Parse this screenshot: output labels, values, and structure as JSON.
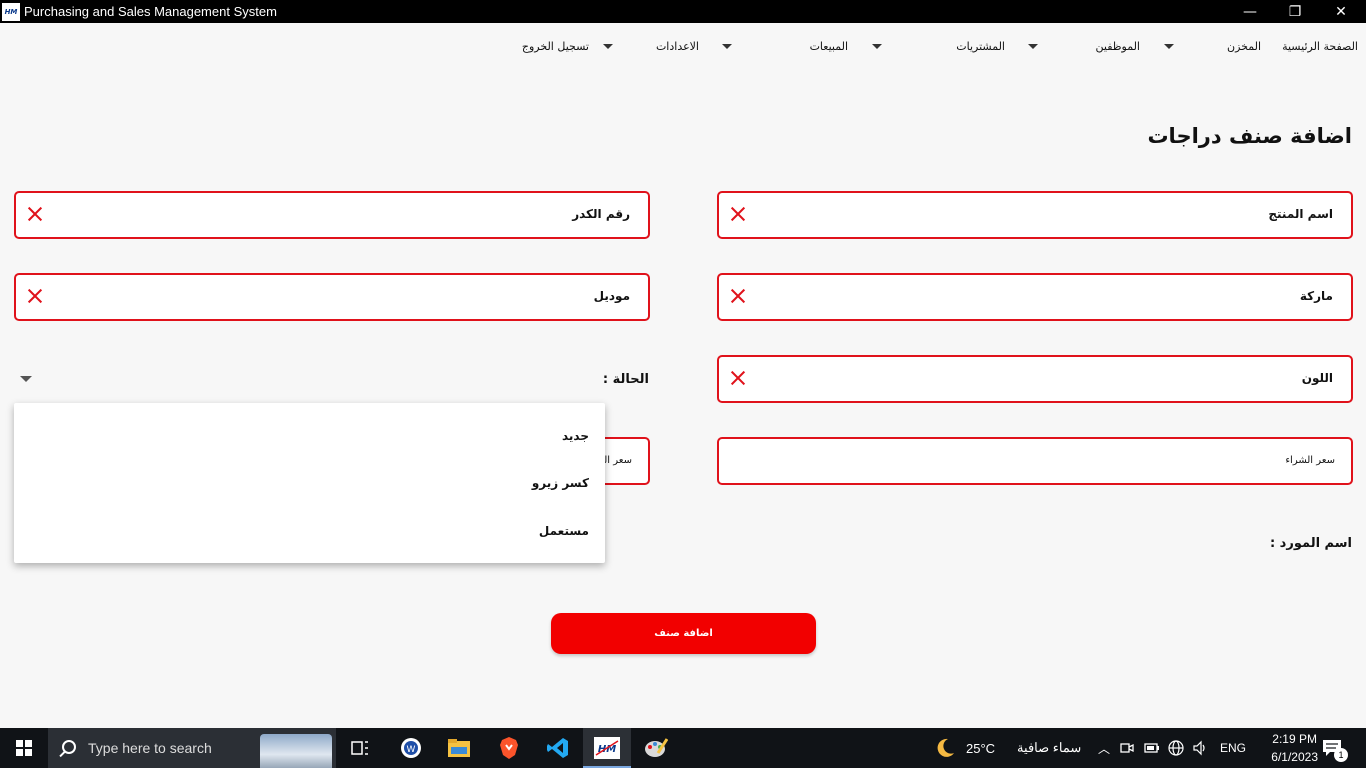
{
  "window": {
    "icon_text": "HM",
    "title": "Purchasing and Sales Management System",
    "minimize": "—",
    "restore": "❐",
    "close": "✕"
  },
  "menu": {
    "home": "الصفحة الرئيسية",
    "warehouse": "المخزن",
    "employees": "الموظفين",
    "purchases": "المشتريات",
    "sales": "المبيعات",
    "settings": "الاعدادات",
    "logout": "تسجيل الخروج"
  },
  "page_title": "اضافة صنف دراجات",
  "form": {
    "product_name": "اسم المنتج",
    "frame_number": "رقم الكدر",
    "brand": "ماركة",
    "model": "موديل",
    "color": "اللون",
    "status_label": "الحالة :",
    "purchase_price": "سعر الشراء",
    "sale_price": "سعر البيع",
    "supplier_label": "اسم المورد :"
  },
  "status_options": [
    "جديد",
    "كسر زيرو",
    "مستعمل"
  ],
  "submit_label": "اضافة صنف",
  "taskbar": {
    "search_placeholder": "Type here to search",
    "weather_temp": "25°C",
    "weather_text": "سماء صافية",
    "language": "ENG",
    "time": "2:19 PM",
    "date": "6/1/2023",
    "notification_count": "1"
  }
}
